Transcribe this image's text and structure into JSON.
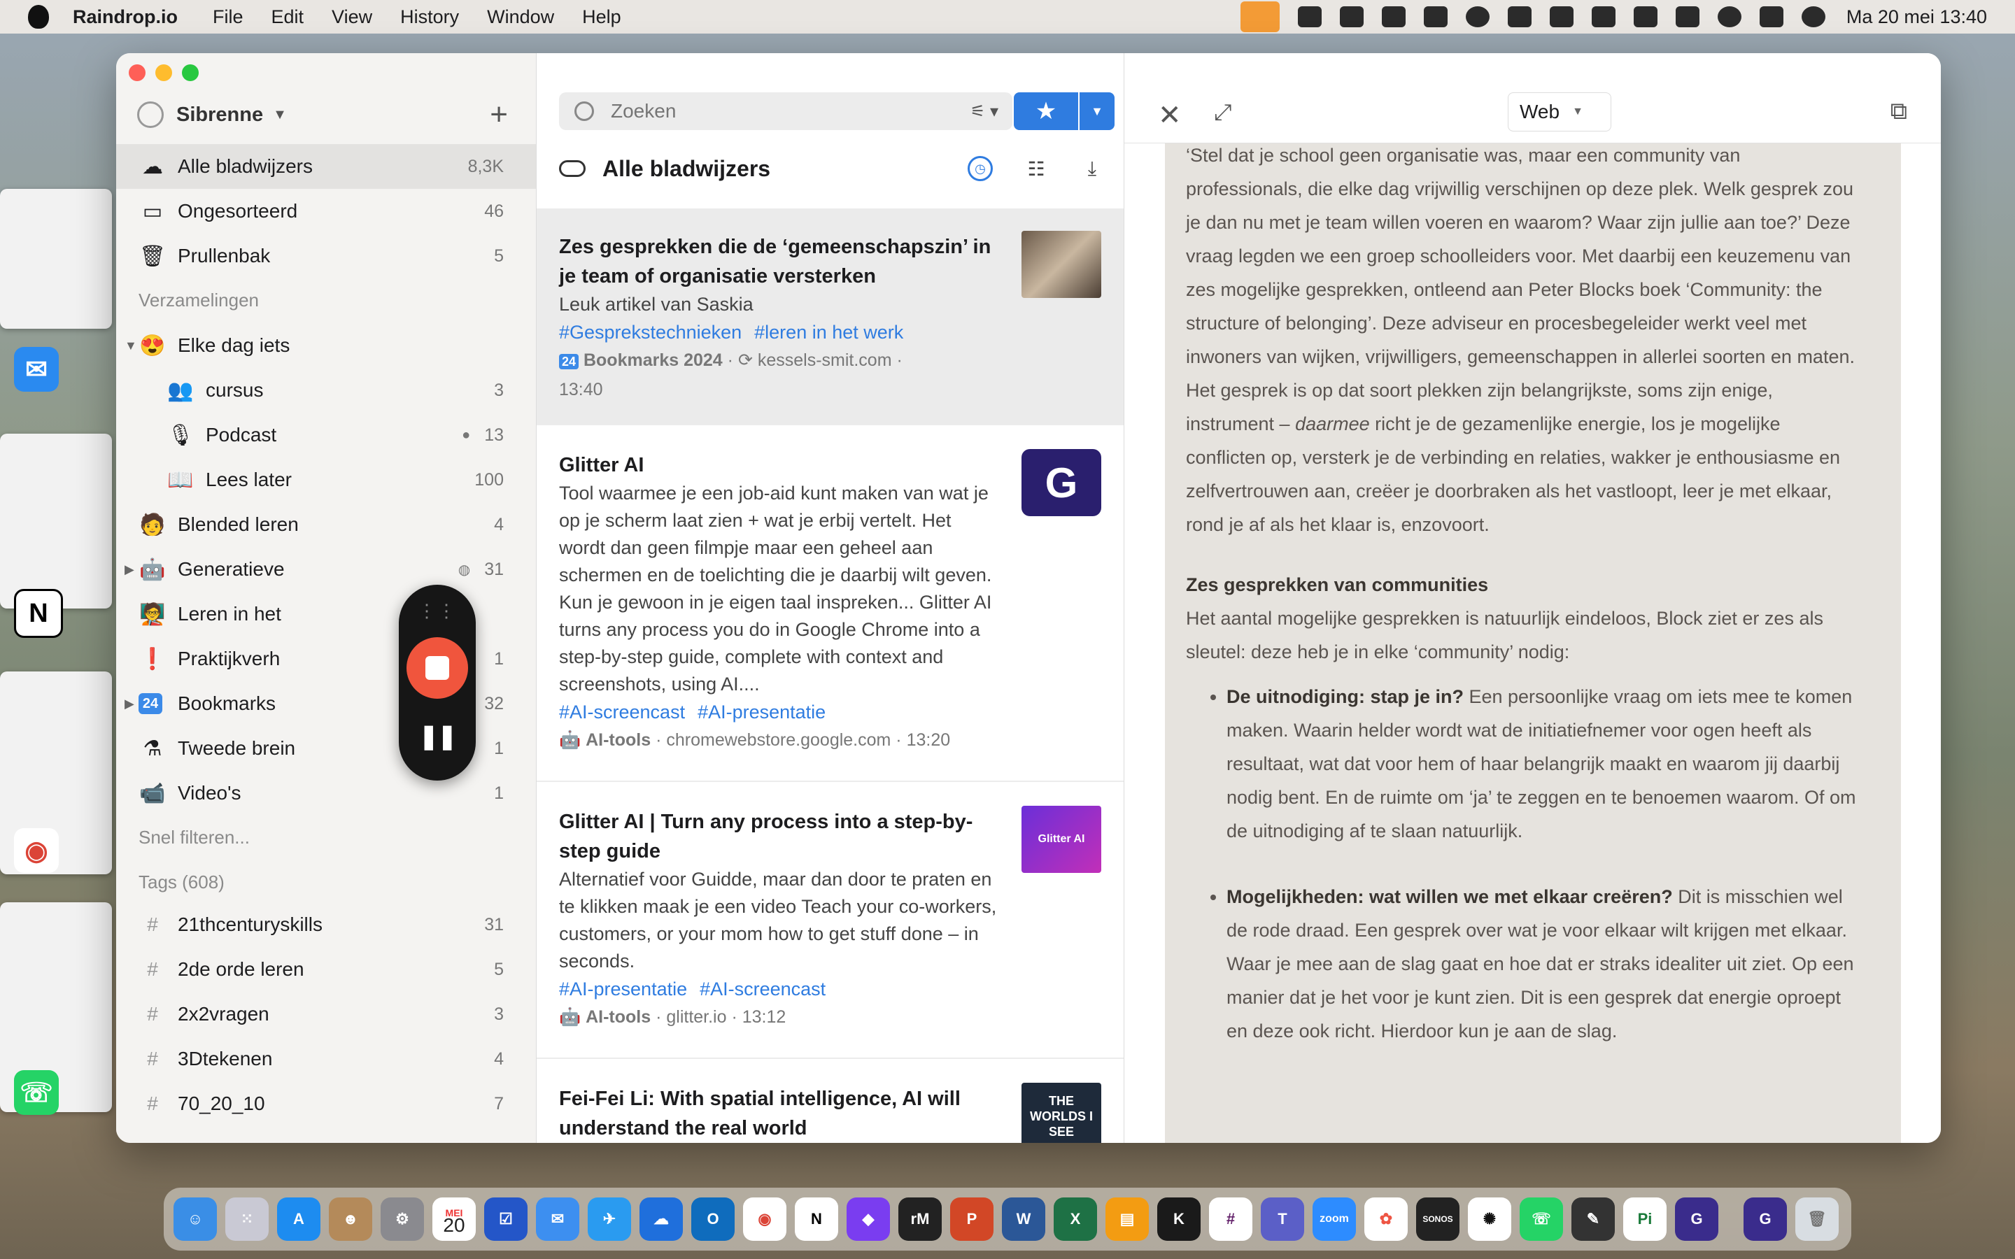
{
  "menubar": {
    "app_name": "Raindrop.io",
    "menus": [
      "File",
      "Edit",
      "View",
      "History",
      "Window",
      "Help"
    ],
    "clock": "Ma 20 mei  13:40"
  },
  "sidebar": {
    "user": "Sibrenne",
    "nav": [
      {
        "label": "Alle bladwijzers",
        "count": "8,3K",
        "icon": "cloud-icon"
      },
      {
        "label": "Ongesorteerd",
        "count": "46",
        "icon": "inbox-icon"
      },
      {
        "label": "Prullenbak",
        "count": "5",
        "icon": "trash-icon"
      }
    ],
    "collections_heading": "Verzamelingen",
    "collections": [
      {
        "label": "Elke dag iets",
        "count": "",
        "icon": "smiley-emoji-icon"
      },
      {
        "label": "cursus",
        "count": "3",
        "icon": "crowd-emoji-icon"
      },
      {
        "label": "Podcast",
        "count": "13",
        "icon": "microphone-emoji-icon"
      },
      {
        "label": "Lees later",
        "count": "100",
        "icon": "reading-person-emoji-icon"
      },
      {
        "label": "Blended leren",
        "count": "4",
        "icon": "person-emoji-icon"
      },
      {
        "label": "Generatieve",
        "count": "31",
        "icon": "robot-emoji-icon"
      },
      {
        "label": "Leren in het",
        "count": "",
        "icon": "teacher-emoji-icon"
      },
      {
        "label": "Praktijkverh",
        "count": "1",
        "icon": "warning-screen-emoji-icon"
      },
      {
        "label": "Bookmarks",
        "count": "32",
        "icon": "calendar-24-icon"
      },
      {
        "label": "Tweede brein",
        "count": "1",
        "icon": "cauldron-emoji-icon"
      },
      {
        "label": "Video's",
        "count": "1",
        "icon": "video-camera-emoji-icon"
      }
    ],
    "quick_filter": "Snel filteren...",
    "tags_heading": "Tags (608)",
    "tags": [
      {
        "label": "21thcenturyskills",
        "count": "31"
      },
      {
        "label": "2de orde leren",
        "count": "5"
      },
      {
        "label": "2x2vragen",
        "count": "3"
      },
      {
        "label": "3Dtekenen",
        "count": "4"
      },
      {
        "label": "70_20_10",
        "count": "7"
      }
    ]
  },
  "list": {
    "search_placeholder": "Zoeken",
    "heading": "Alle bladwijzers",
    "items": [
      {
        "title": "Zes gesprekken die de ‘gemeenschapszin’ in je team of organisatie versterken",
        "description": "Leuk artikel van Saskia",
        "tags": [
          "#Gesprekstechnieken",
          "#leren in het werk"
        ],
        "collection": "Bookmarks 2024",
        "domain": "kessels-smit.com",
        "time": "13:40"
      },
      {
        "title": "Glitter AI",
        "description": "Tool waarmee je een job-aid kunt maken van wat je op je scherm laat zien + wat je erbij vertelt. Het wordt dan geen filmpje maar een geheel aan schermen en de toelichting die je daarbij wilt geven. Kun je gewoon in je eigen taal inspreken... Glitter AI turns any process you do in Google Chrome into a step-by-step guide, complete with context and screenshots, using AI....",
        "tags": [
          "#AI-screencast",
          "#AI-presentatie"
        ],
        "collection": "AI-tools",
        "domain": "chromewebstore.google.com",
        "time": "13:20",
        "thumb": "G"
      },
      {
        "title": "Glitter AI | Turn any process into a step-by-step guide",
        "description": "Alternatief voor Guidde, maar dan door te praten en te klikken maak je een video Teach your co-workers, customers, or your mom how to get stuff done – in seconds.",
        "tags": [
          "#AI-presentatie",
          "#AI-screencast"
        ],
        "collection": "AI-tools",
        "domain": "glitter.io",
        "time": "13:12",
        "thumb": "Glitter AI"
      },
      {
        "title": "Fei-Fei Li: With spatial intelligence, AI will understand the real world",
        "thumb": "THE WORLDS I SEE"
      }
    ]
  },
  "reader": {
    "mode": "Web",
    "intro": "‘Stel dat je school geen organisatie was, maar een community van professionals, die elke dag vrijwillig verschijnen op deze plek. Welk gesprek zou je dan nu met je team willen voeren en waarom? Waar zijn jullie aan toe?’ Deze vraag legden we een groep schoolleiders voor. Met daarbij een keuzemenu van zes mogelijke gesprekken, ontleend aan Peter Blocks boek ‘Community: the structure of belonging’. Deze adviseur en procesbegeleider werkt veel met inwoners van wijken, vrijwilligers, gemeenschappen in allerlei soorten en maten. Het gesprek is op dat soort plekken zijn belangrijkste, soms zijn enige, instrument –",
    "intro_em": "daarmee",
    "intro_rest": " richt je de gezamenlijke energie, los je mogelijke conflicten op, versterk je de verbinding en relaties, wakker je enthousiasme en zelfvertrouwen aan, creëer je doorbraken als het vastloopt, leer je met elkaar, rond je af als het klaar is, enzovoort.",
    "heading": "Zes gesprekken van communities",
    "para2": "Het aantal mogelijke gesprekken is natuurlijk eindeloos, Block ziet er zes als sleutel: deze heb je in elke ‘community’ nodig:",
    "bullets": [
      {
        "bold": "De uitnodiging: stap je in?",
        "text": " Een persoonlijke vraag om iets mee te komen maken. Waarin helder wordt wat de initiatiefnemer voor ogen heeft als resultaat, wat dat voor hem of haar belangrijk maakt en waarom jij daarbij nodig bent. En de ruimte om ‘ja’ te zeggen en te benoemen waarom. Of om de uitnodiging af te slaan natuurlijk."
      },
      {
        "bold": "Mogelijkheden: wat willen we met elkaar creëren?",
        "text": " Dit is misschien wel de rode draad. Een gesprek over wat je voor elkaar wilt krijgen met elkaar. Waar je mee aan de slag gaat en hoe dat er straks idealiter uit ziet. Op een manier dat je het voor je kunt zien. Dit is een gesprek dat energie oproept en deze ook richt. Hierdoor kun je aan de slag."
      }
    ]
  },
  "dock": {
    "calendar_month": "MEI",
    "calendar_day": "20"
  },
  "colors": {
    "accent": "#2f7ce0",
    "reader_bg": "#e6e3de",
    "record": "#f0553d"
  }
}
